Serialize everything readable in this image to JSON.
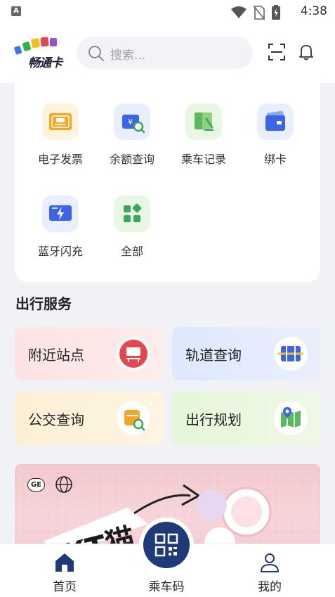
{
  "status_bar": {
    "time": "4:38",
    "notification_letter": "A"
  },
  "header": {
    "logo_text": "畅通卡",
    "search_placeholder": "搜索..."
  },
  "quick_actions": [
    {
      "label": "电子发票",
      "icon": "e-invoice-icon"
    },
    {
      "label": "余额查询",
      "icon": "balance-query-icon"
    },
    {
      "label": "乘车记录",
      "icon": "ride-record-icon"
    },
    {
      "label": "绑卡",
      "icon": "bind-card-icon"
    },
    {
      "label": "蓝牙闪充",
      "icon": "bluetooth-charge-icon"
    },
    {
      "label": "全部",
      "icon": "all-apps-icon"
    }
  ],
  "travel_section": {
    "title": "出行服务",
    "services": [
      {
        "label": "附近站点",
        "icon": "bus-stop-icon"
      },
      {
        "label": "轨道查询",
        "icon": "rail-query-icon"
      },
      {
        "label": "公交查询",
        "icon": "bus-query-icon"
      },
      {
        "label": "出行规划",
        "icon": "map-plan-icon"
      }
    ]
  },
  "banner": {
    "text": "KT猫",
    "badge": "GE"
  },
  "tabbar": {
    "home": "首页",
    "ride_code": "乘车码",
    "mine": "我的"
  },
  "colors": {
    "accent_navy": "#1f3a78",
    "icon_blue": "#3d63e6",
    "icon_orange": "#f5a623",
    "icon_green": "#3ba55c",
    "icon_red": "#e4484f"
  }
}
